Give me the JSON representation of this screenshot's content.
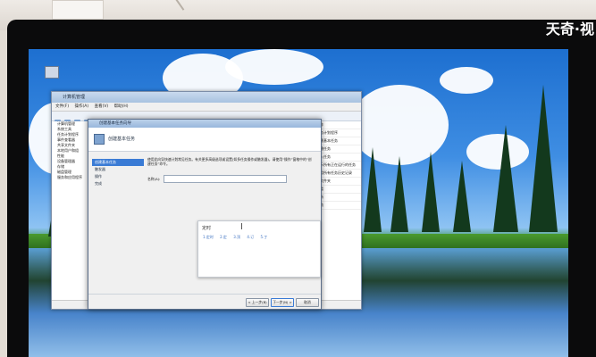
{
  "watermark": "天奇·视",
  "explorer": {
    "title": "计算机管理",
    "menu": [
      "文件(F)",
      "操作(A)",
      "查看(V)",
      "帮助(H)"
    ],
    "tree_items": [
      "计算机管理",
      "系统工具",
      "任务计划程序",
      "事件查看器",
      "共享文件夹",
      "本地用户和组",
      "性能",
      "设备管理器",
      "存储",
      "磁盘管理",
      "服务和应用程序"
    ],
    "right_items": [
      "操作",
      "任务计划程序",
      "创建基本任务",
      "创建任务",
      "导入任务",
      "显示所有正在运行的任务",
      "启用所有任务历史记录",
      "新文件夹",
      "查看",
      "刷新",
      "帮助"
    ],
    "status": "上次刷新时间: 2017/1/23 9:45:17"
  },
  "dialog": {
    "title": "创建基本任务向导",
    "header": "创建基本任务",
    "steps": [
      {
        "label": "创建基本任务",
        "active": true
      },
      {
        "label": "触发器",
        "active": false
      },
      {
        "label": "操作",
        "active": false
      },
      {
        "label": "完成",
        "active": false
      }
    ],
    "description": "使用此向导快速计划常见任务。有关更多高级选项或设置(如多任务操作或触发器)，请使用“操作”窗格中的“创建任务”命令。",
    "name_label": "名称(A):",
    "buttons": {
      "back": "< 上一步(B)",
      "next": "下一步(N) >",
      "cancel": "取消"
    }
  },
  "ime_popup": {
    "input": "定时",
    "candidates": [
      "1.定时",
      "2.定",
      "3.顶",
      "4.订",
      "5.丁"
    ]
  }
}
